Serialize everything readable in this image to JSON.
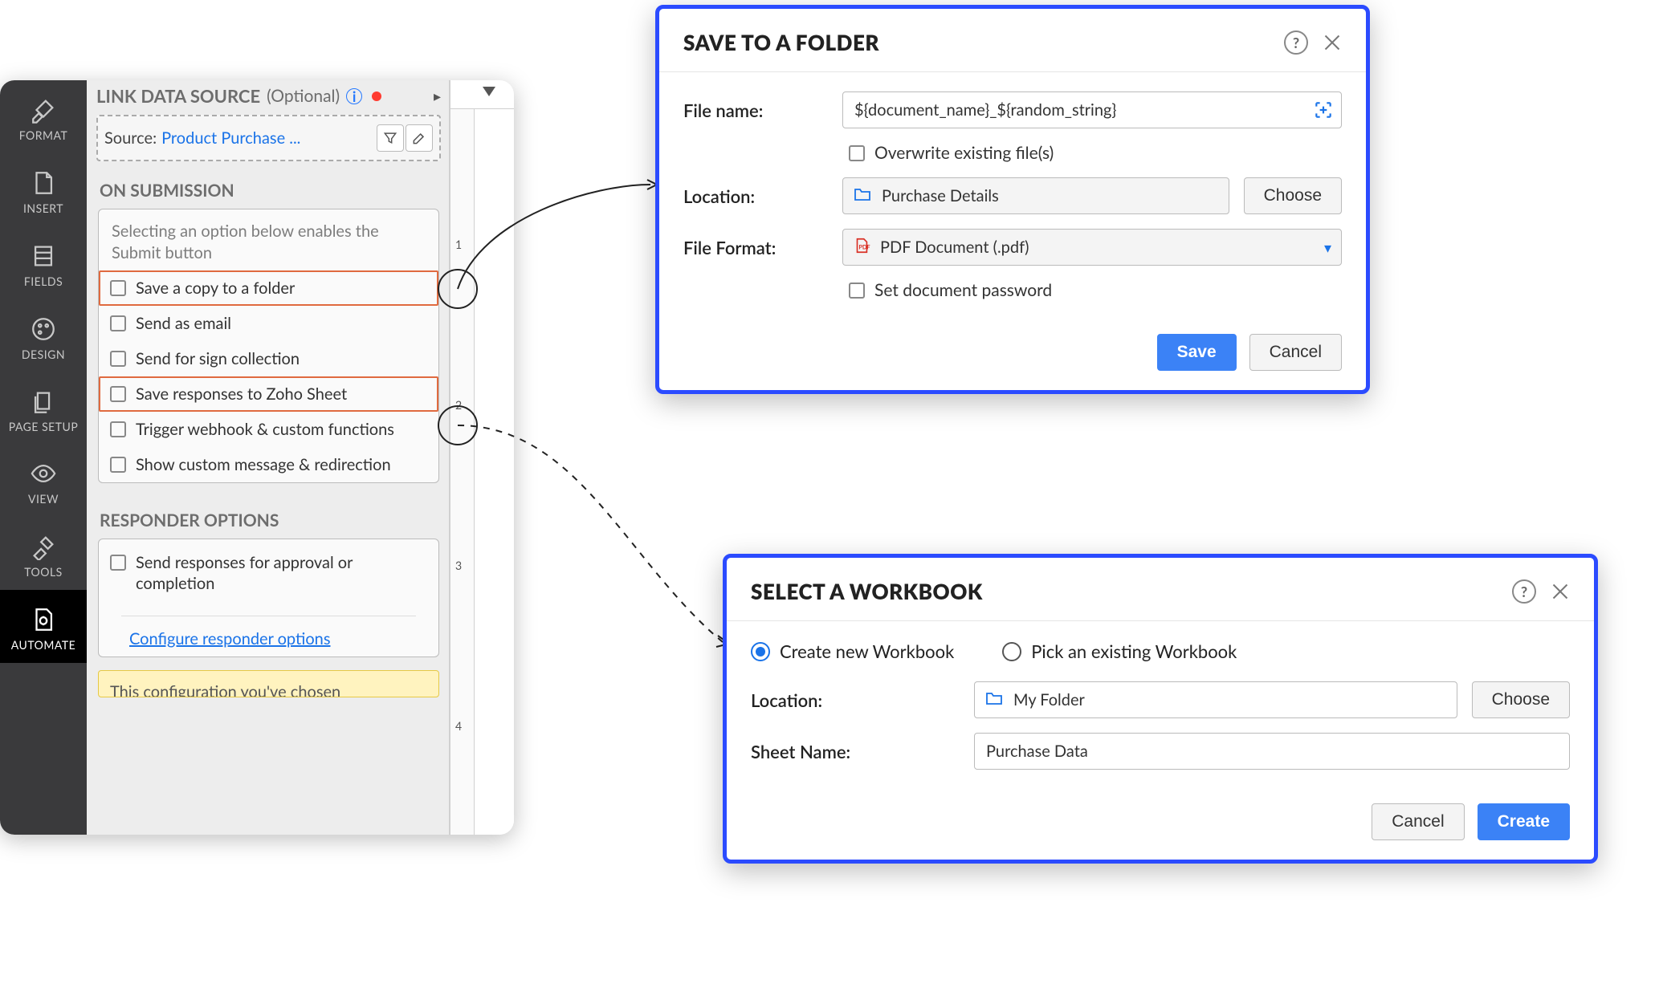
{
  "sidebar": {
    "items": [
      {
        "label": "FORMAT"
      },
      {
        "label": "INSERT"
      },
      {
        "label": "FIELDS"
      },
      {
        "label": "DESIGN"
      },
      {
        "label": "PAGE SETUP"
      },
      {
        "label": "VIEW"
      },
      {
        "label": "TOOLS"
      },
      {
        "label": "AUTOMATE"
      }
    ]
  },
  "panel": {
    "title": "LINK DATA SOURCE",
    "optional": "(Optional)",
    "source_prefix": "Source:",
    "source_value": "Product Purchase ...",
    "on_submission_title": "ON SUBMISSION",
    "help": "Selecting an option below enables the Submit button",
    "options": [
      {
        "label": "Save a copy to a folder",
        "highlight": true
      },
      {
        "label": "Send as email",
        "highlight": false
      },
      {
        "label": "Send for sign collection",
        "highlight": false
      },
      {
        "label": "Save responses to Zoho Sheet",
        "highlight": true
      },
      {
        "label": "Trigger webhook & custom functions",
        "highlight": false
      },
      {
        "label": "Show custom message & redirection",
        "highlight": false
      }
    ],
    "responder_title": "RESPONDER OPTIONS",
    "responder_option": "Send responses for approval or completion",
    "responder_link": "Configure responder options",
    "yellow_text": "This configuration you've chosen"
  },
  "dialog_save": {
    "title": "SAVE TO A FOLDER",
    "file_name_label": "File name:",
    "file_name_value": "${document_name}_${random_string}",
    "overwrite_label": "Overwrite existing file(s)",
    "location_label": "Location:",
    "location_value": "Purchase Details",
    "choose_label": "Choose",
    "format_label": "File Format:",
    "format_value": "PDF Document (.pdf)",
    "password_label": "Set document password",
    "save_btn": "Save",
    "cancel_btn": "Cancel"
  },
  "dialog_wb": {
    "title": "SELECT A WORKBOOK",
    "radio_new": "Create new Workbook",
    "radio_existing": "Pick an existing Workbook",
    "location_label": "Location:",
    "location_value": "My Folder",
    "choose_label": "Choose",
    "sheet_label": "Sheet Name:",
    "sheet_value": "Purchase Data",
    "cancel_btn": "Cancel",
    "create_btn": "Create"
  }
}
